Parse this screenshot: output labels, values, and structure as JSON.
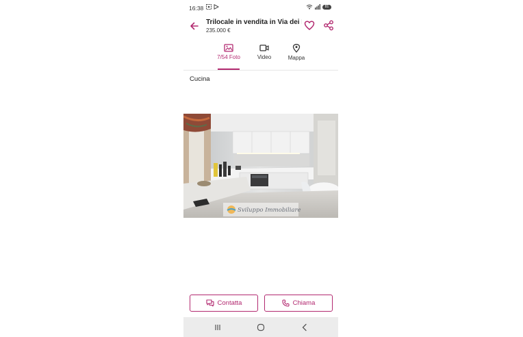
{
  "status": {
    "time": "16:38",
    "battery": "81"
  },
  "header": {
    "title": "Trilocale in vendita in Via dei L...",
    "price": "235.000 €"
  },
  "tabs": [
    {
      "label": "7/54 Foto",
      "icon": "image-icon",
      "active": true
    },
    {
      "label": "Video",
      "icon": "video-icon",
      "active": false
    },
    {
      "label": "Mappa",
      "icon": "map-pin-icon",
      "active": false
    }
  ],
  "photo": {
    "caption": "Cucina",
    "watermark": "Sviluppo Immobiliare"
  },
  "actions": {
    "contact_label": "Contatta",
    "call_label": "Chiama"
  },
  "colors": {
    "accent": "#b2286f"
  }
}
